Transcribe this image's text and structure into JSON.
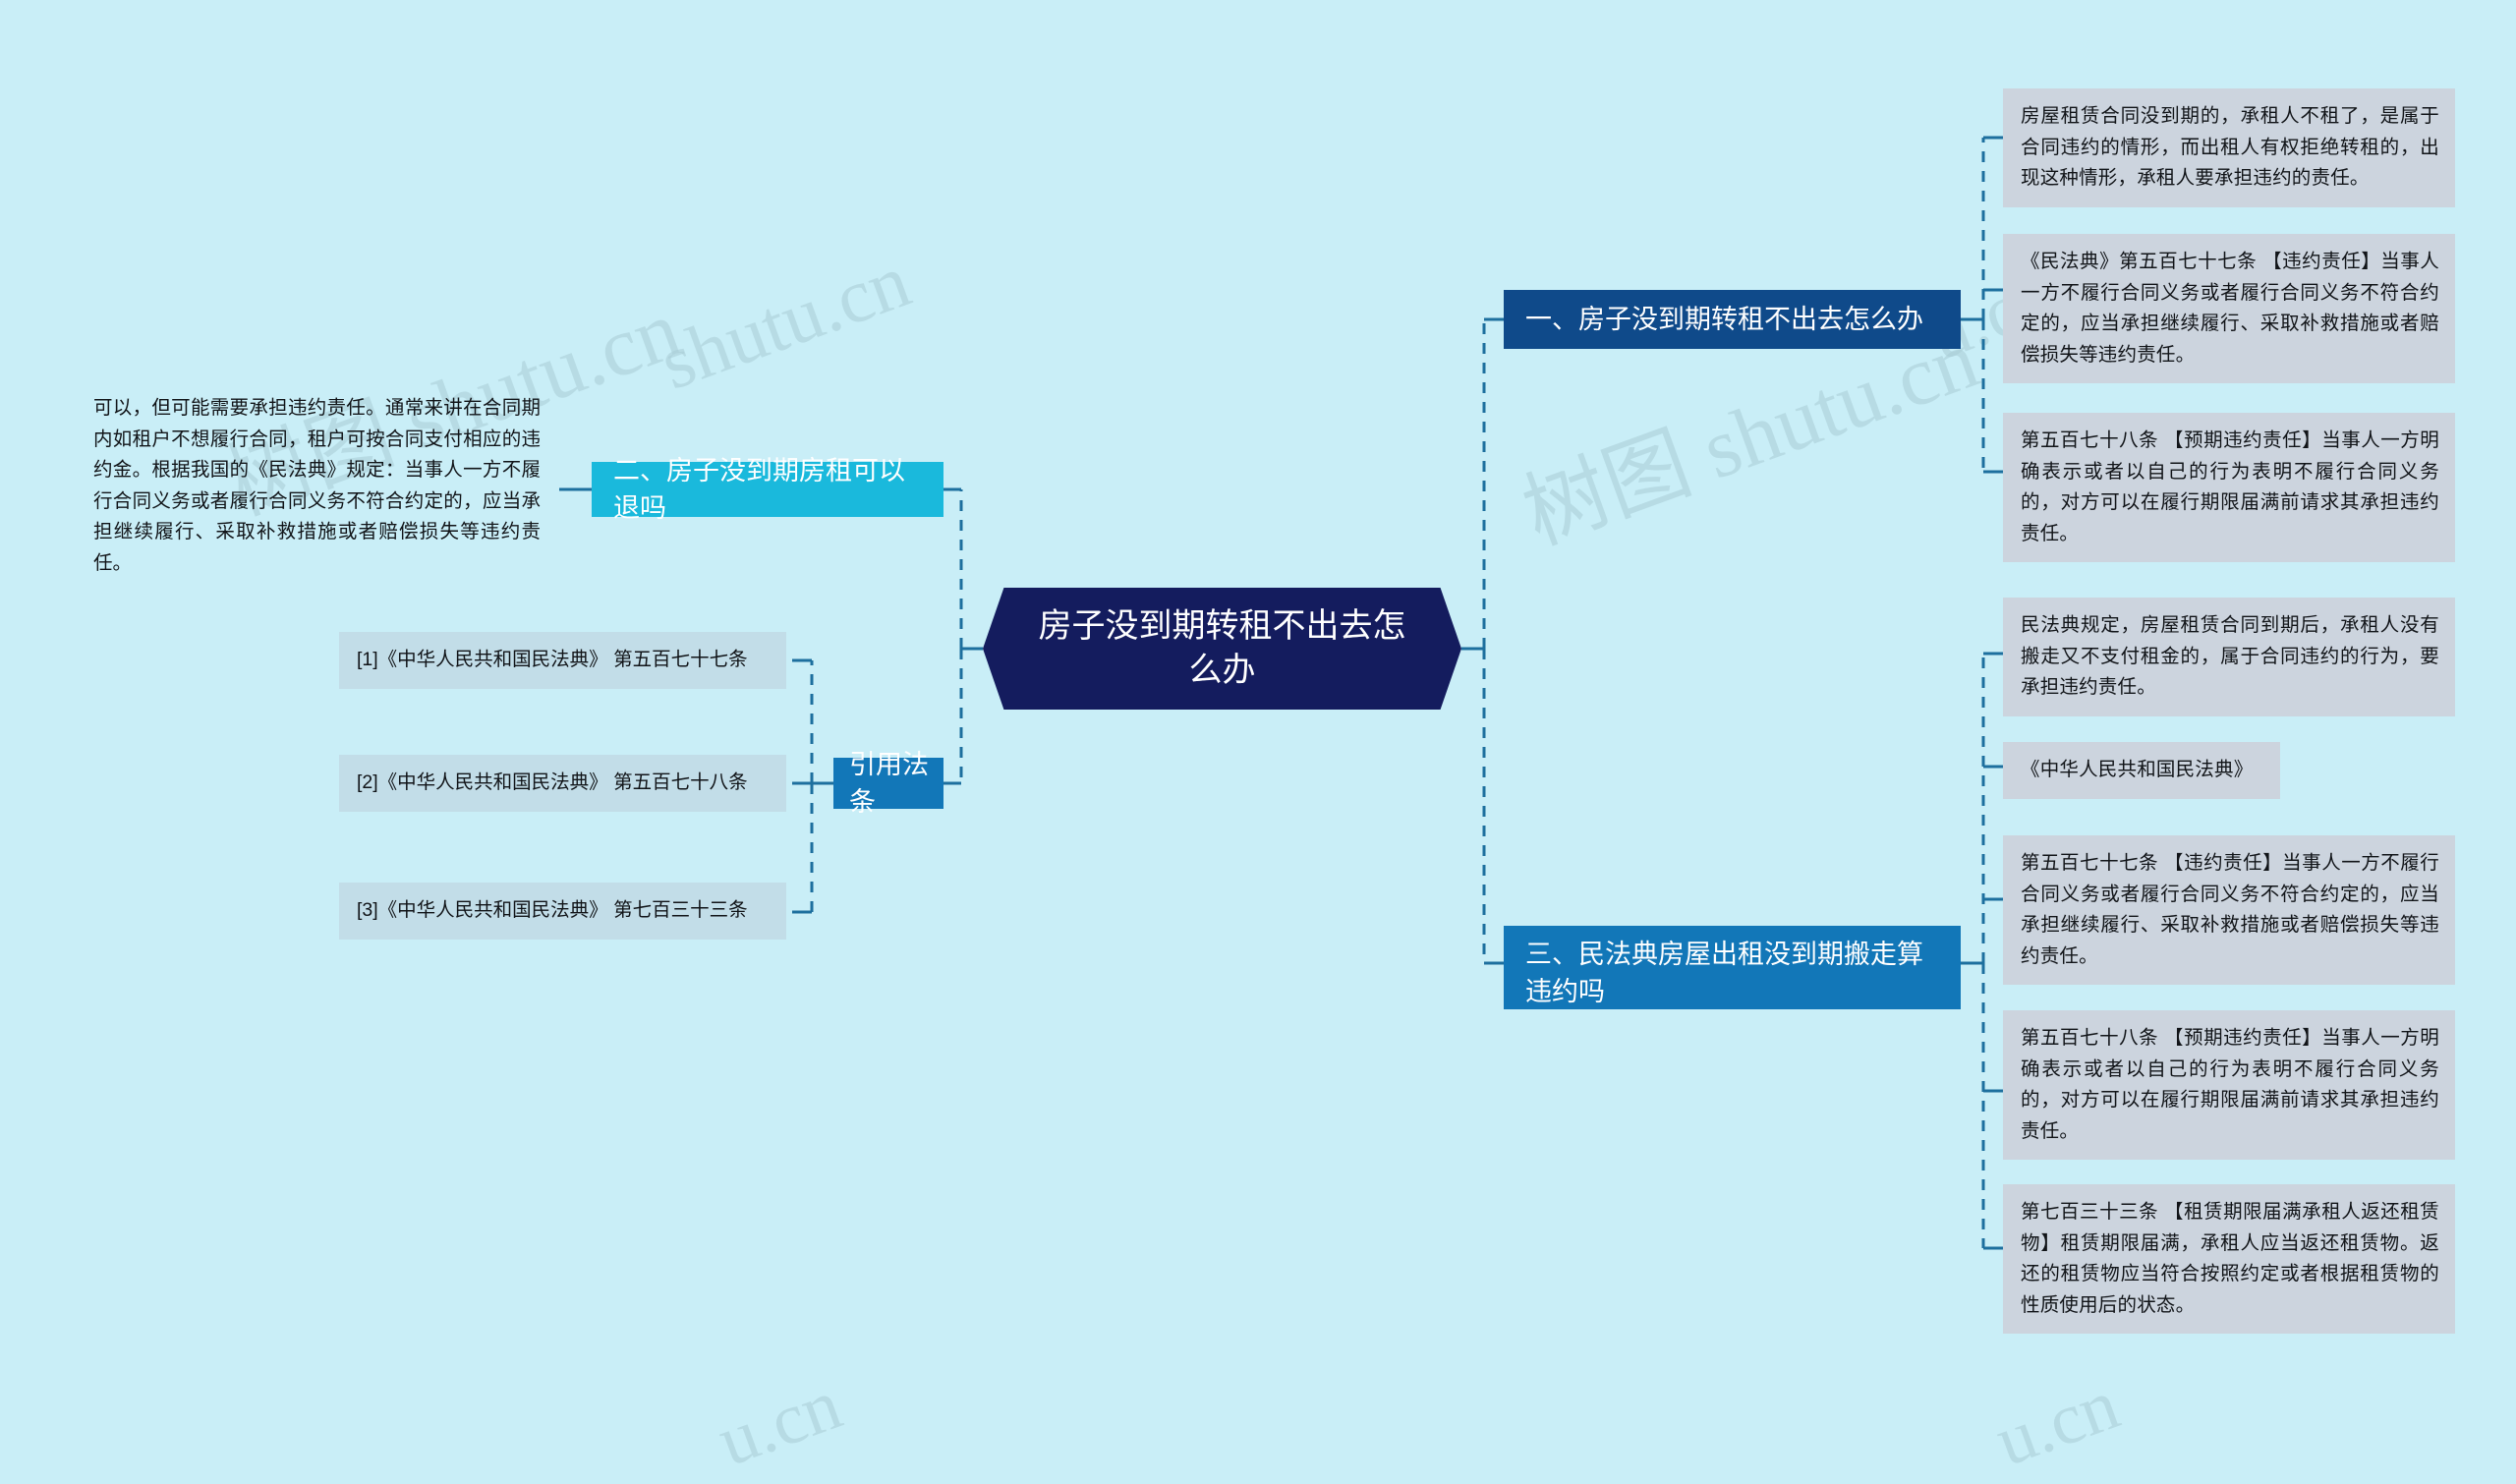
{
  "theme": {
    "background": "#c9eef7",
    "root_fill": "#141c5e",
    "branch_dark_fill": "#0f4a8a",
    "branch_mid_fill": "#1277b8",
    "branch_cyan_fill": "#1ab9dc",
    "leaf_fill": "#ccd4de",
    "connector": "#1d6f9e",
    "text_light": "#ffffff",
    "text_dark": "#111418"
  },
  "watermark": {
    "text_a": "树图 shutu.cn",
    "text_b": "shutu.cn",
    "text_c": "u.cn",
    "text_d": "cn"
  },
  "root": {
    "label": "房子没到期转租不出去怎么办"
  },
  "branches": [
    {
      "id": "branch-1",
      "label": "一、房子没到期转租不出去怎么办",
      "children": [
        {
          "id": "b1-c1",
          "text": "房屋租赁合同没到期的，承租人不租了，是属于合同违约的情形，而出租人有权拒绝转租的，出现这种情形，承租人要承担违约的责任。"
        },
        {
          "id": "b1-c2",
          "text": "《民法典》第五百七十七条 【违约责任】当事人一方不履行合同义务或者履行合同义务不符合约定的，应当承担继续履行、采取补救措施或者赔偿损失等违约责任。"
        },
        {
          "id": "b1-c3",
          "text": "第五百七十八条 【预期违约责任】当事人一方明确表示或者以自己的行为表明不履行合同义务的，对方可以在履行期限届满前请求其承担违约责任。"
        }
      ]
    },
    {
      "id": "branch-2",
      "label": "二、房子没到期房租可以退吗",
      "children": [
        {
          "id": "b2-c1",
          "text": "可以，但可能需要承担违约责任。通常来讲在合同期内如租户不想履行合同，租户可按合同支付相应的违约金。根据我国的《民法典》规定：当事人一方不履行合同义务或者履行合同义务不符合约定的，应当承担继续履行、采取补救措施或者赔偿损失等违约责任。"
        }
      ]
    },
    {
      "id": "branch-3",
      "label": "三、民法典房屋出租没到期搬走算违约吗",
      "children": [
        {
          "id": "b3-c1",
          "text": "民法典规定，房屋租赁合同到期后，承租人没有搬走又不支付租金的，属于合同违约的行为，要承担违约责任。"
        },
        {
          "id": "b3-c2",
          "text": "《中华人民共和国民法典》"
        },
        {
          "id": "b3-c3",
          "text": "第五百七十七条 【违约责任】当事人一方不履行合同义务或者履行合同义务不符合约定的，应当承担继续履行、采取补救措施或者赔偿损失等违约责任。"
        },
        {
          "id": "b3-c4",
          "text": "第五百七十八条 【预期违约责任】当事人一方明确表示或者以自己的行为表明不履行合同义务的，对方可以在履行期限届满前请求其承担违约责任。"
        },
        {
          "id": "b3-c5",
          "text": "第七百三十三条 【租赁期限届满承租人返还租赁物】租赁期限届满，承租人应当返还租赁物。返还的租赁物应当符合按照约定或者根据租赁物的性质使用后的状态。"
        }
      ]
    },
    {
      "id": "branch-4",
      "label": "引用法条",
      "children": [
        {
          "id": "b4-c1",
          "text": "[1]《中华人民共和国民法典》 第五百七十七条"
        },
        {
          "id": "b4-c2",
          "text": "[2]《中华人民共和国民法典》 第五百七十八条"
        },
        {
          "id": "b4-c3",
          "text": "[3]《中华人民共和国民法典》 第七百三十三条"
        }
      ]
    }
  ]
}
